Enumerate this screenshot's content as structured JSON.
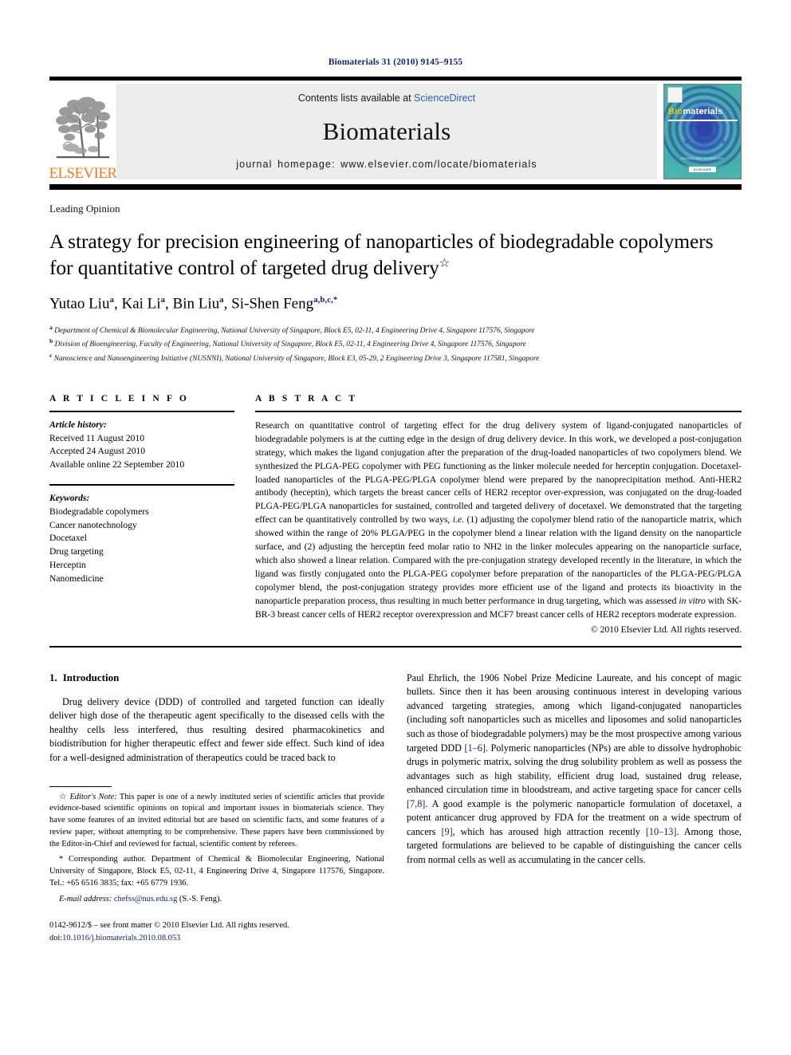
{
  "running_head": "Biomaterials 31 (2010) 9145–9155",
  "masthead": {
    "contents_prefix": "Contents lists available at ",
    "contents_link": "ScienceDirect",
    "journal_name": "Biomaterials",
    "homepage": "journal homepage: www.elsevier.com/locate/biomaterials",
    "publisher_name": "ELSEVIER",
    "cover": {
      "title_part1": "Bio",
      "title_part2": "materials",
      "footer_line1": "SCIENCE AND TECHNOLOGY",
      "footer_line2": "ELSEVIER",
      "background_color": "#3aa8a8",
      "accent_color": "#f2c600"
    }
  },
  "article": {
    "section_label": "Leading Opinion",
    "title": "A strategy for precision engineering of nanoparticles of biodegradable copolymers for quantitative control of targeted drug delivery",
    "title_marker": "☆",
    "authors_html": "Yutao Liu<sup>a</sup>, Kai Li<sup>a</sup>, Bin Liu<sup>a</sup>, Si-Shen Feng<sup>a,b,c,*</sup>",
    "affiliations": [
      {
        "mark": "a",
        "text": "Department of Chemical & Biomolecular Engineering, National University of Singapore, Block E5, 02-11, 4 Engineering Drive 4, Singapore 117576, Singapore"
      },
      {
        "mark": "b",
        "text": "Division of Bioengineering, Faculty of Engineering, National University of Singapore, Block E5, 02-11, 4 Engineering Drive 4, Singapore 117576, Singapore"
      },
      {
        "mark": "c",
        "text": "Nanoscience and Nanoengineering Initiative (NUSNNI), National University of Singapore, Block E3, 05-29, 2 Engineering Drive 3, Singapore 117581, Singapore"
      }
    ]
  },
  "article_info": {
    "heading": "A R T I C L E   I N F O",
    "history_label": "Article history:",
    "history": [
      "Received 11 August 2010",
      "Accepted 24 August 2010",
      "Available online 22 September 2010"
    ],
    "keywords_label": "Keywords:",
    "keywords": [
      "Biodegradable copolymers",
      "Cancer nanotechnology",
      "Docetaxel",
      "Drug targeting",
      "Herceptin",
      "Nanomedicine"
    ]
  },
  "abstract": {
    "heading": "A B S T R A C T",
    "text_part1": "Research on quantitative control of targeting effect for the drug delivery system of ligand-conjugated nanoparticles of biodegradable polymers is at the cutting edge in the design of drug delivery device. In this work, we developed a post-conjugation strategy, which makes the ligand conjugation after the preparation of the drug-loaded nanoparticles of two copolymers blend. We synthesized the PLGA-PEG copolymer with PEG functioning as the linker molecule needed for herceptin conjugation. Docetaxel-loaded nanoparticles of the PLGA-PEG/PLGA copolymer blend were prepared by the nanoprecipitation method. Anti-HER2 antibody (heceptin), which targets the breast cancer cells of HER2 receptor over-expression, was conjugated on the drug-loaded PLGA-PEG/PLGA nanoparticles for sustained, controlled and targeted delivery of docetaxel. We demonstrated that the targeting effect can be quantitatively controlled by two ways, ",
    "italic1": "i.e.",
    "text_part2": " (1) adjusting the copolymer blend ratio of the nanoparticle matrix, which showed within the range of 20% PLGA/PEG in the copolymer blend a linear relation with the ligand density on the nanoparticle surface, and (2) adjusting the herceptin feed molar ratio to NH2 in the linker molecules appearing on the nanoparticle surface, which also showed a linear relation. Compared with the pre-conjugation strategy developed recently in the literature, in which the ligand was firstly conjugated onto the PLGA-PEG copolymer before preparation of the nanoparticles of the PLGA-PEG/PLGA copolymer blend, the post-conjugation strategy provides more efficient use of the ligand and protects its bioactivity in the nanoparticle preparation process, thus resulting in much better performance in drug targeting, which was assessed ",
    "italic2": "in vitro",
    "text_part3": " with SK-BR-3 breast cancer cells of HER2 receptor overexpression and MCF7 breast cancer cells of HER2 receptors moderate expression.",
    "copyright": "© 2010 Elsevier Ltd. All rights reserved."
  },
  "introduction": {
    "number": "1.",
    "heading": "Introduction",
    "para1": "Drug delivery device (DDD) of controlled and targeted function can ideally deliver high dose of the therapeutic agent specifically to the diseased cells with the healthy cells less interfered, thus resulting desired pharmacokinetics and biodistribution for higher therapeutic effect and fewer side effect. Such kind of idea for a well-designed administration of therapeutics could be traced back to",
    "para2_a": "Paul Ehrlich, the 1906 Nobel Prize Medicine Laureate, and his concept of magic bullets. Since then it has been arousing continuous interest in developing various advanced targeting strategies, among which ligand-conjugated nanoparticles (including soft nanoparticles such as micelles and liposomes and solid nanoparticles such as those of biodegradable polymers) may be the most prospective among various targeted DDD ",
    "ref1": "[1–6]",
    "para2_b": ". Polymeric nanoparticles (NPs) are able to dissolve hydrophobic drugs in polymeric matrix, solving the drug solubility problem as well as possess the advantages such as high stability, efficient drug load, sustained drug release, enhanced circulation time in bloodstream, and active targeting space for cancer cells ",
    "ref2": "[7,8]",
    "para2_c": ". A good example is the polymeric nanoparticle formulation of docetaxel, a potent anticancer drug approved by FDA for the treatment on a wide spectrum of cancers ",
    "ref3": "[9]",
    "para2_d": ", which has aroused high attraction recently ",
    "ref4": "[10–13]",
    "para2_e": ". Among those, targeted formulations are believed to be capable of distinguishing the cancer cells from normal cells as well as accumulating in the cancer cells."
  },
  "footnotes": {
    "editor_note_mark": "☆",
    "editor_note_label": "Editor's Note:",
    "editor_note_text": " This paper is one of a newly instituted series of scientific articles that provide evidence-based scientific opinions on topical and important issues in biomaterials science. They have some features of an invited editorial but are based on scientific facts, and some features of a review paper, without attempting to be comprehensive. These papers have been commissioned by the Editor-in-Chief and reviewed for factual, scientific content by referees.",
    "corresponding_mark": "*",
    "corresponding_text": " Corresponding author. Department of Chemical & Biomolecular Engineering, National University of Singapore, Block E5, 02-11, 4 Engineering Drive 4, Singapore 117576, Singapore. Tel.: +65 6516 3835; fax: +65 6779 1936.",
    "email_label": "E-mail address:",
    "email": "chefss@nus.edu.sg",
    "email_suffix": " (S.-S. Feng)."
  },
  "imprint": {
    "line1": "0142-9612/$ – see front matter © 2010 Elsevier Ltd. All rights reserved.",
    "doi_prefix": "doi:",
    "doi": "10.1016/j.biomaterials.2010.08.053"
  }
}
